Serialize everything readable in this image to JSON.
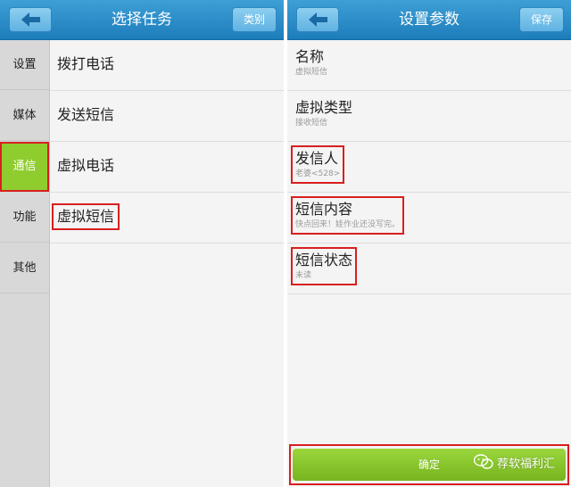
{
  "left": {
    "title": "选择任务",
    "right_button": "类别",
    "sidebar": [
      {
        "label": "设置"
      },
      {
        "label": "媒体"
      },
      {
        "label": "通信",
        "active": true
      },
      {
        "label": "功能"
      },
      {
        "label": "其他"
      }
    ],
    "tasks": [
      {
        "label": "拨打电话"
      },
      {
        "label": "发送短信"
      },
      {
        "label": "虚拟电话"
      },
      {
        "label": "虚拟短信",
        "highlight": true
      }
    ]
  },
  "right": {
    "title": "设置参数",
    "right_button": "保存",
    "params": [
      {
        "title": "名称",
        "value": "虚拟短信"
      },
      {
        "title": "虚拟类型",
        "value": "接收短信"
      },
      {
        "title": "发信人",
        "value": "老婆<528>",
        "highlight": true
      },
      {
        "title": "短信内容",
        "value": "快点回来！娃作业还没写完。",
        "highlight": true
      },
      {
        "title": "短信状态",
        "value": "未读",
        "highlight": true
      }
    ],
    "confirm": "确定"
  },
  "watermark": "荐软福利汇",
  "colors": {
    "header": "#2a8ac6",
    "accent_green": "#8fcc2e",
    "highlight_red": "#d81f1f"
  },
  "icons": {
    "back": "back-arrow-icon",
    "watermark": "wechat-icon"
  }
}
